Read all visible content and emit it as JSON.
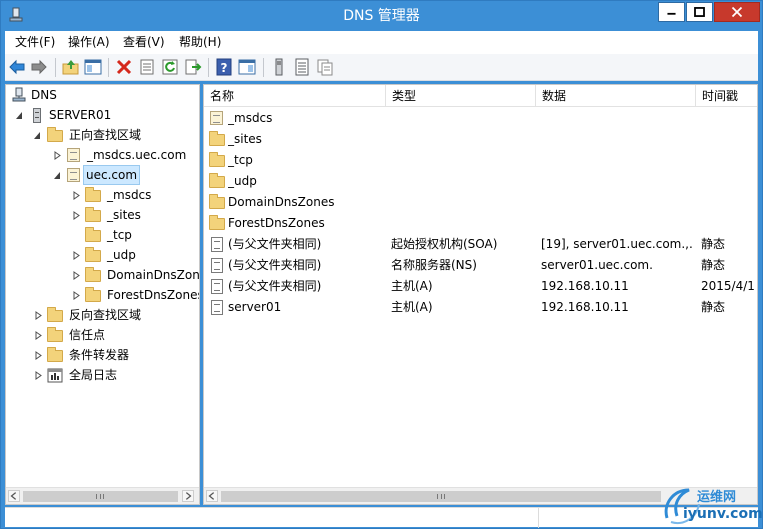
{
  "window": {
    "title": "DNS 管理器",
    "accent": "#3c8fd6",
    "close_color": "#c7392c"
  },
  "menu": {
    "items": [
      {
        "label": "文件(F)"
      },
      {
        "label": "操作(A)"
      },
      {
        "label": "查看(V)"
      },
      {
        "label": "帮助(H)"
      }
    ]
  },
  "toolbar": {
    "buttons": [
      "back-arrow-icon",
      "forward-arrow-icon",
      "up-folder-icon",
      "show-hide-console-tree-icon",
      "delete-icon",
      "properties-icon",
      "refresh-icon",
      "export-list-icon",
      "help-icon",
      "show-hide-action-pane-icon",
      "server-icon",
      "zone-list-icon",
      "copy-record-icon"
    ]
  },
  "tree": {
    "items": [
      {
        "label": "DNS",
        "icon": "dns-root-icon"
      },
      {
        "label": "SERVER01",
        "icon": "server-icon",
        "expander": "expanded"
      },
      {
        "label": "正向查找区域",
        "icon": "folder-icon",
        "expander": "expanded"
      },
      {
        "label": "_msdcs.uec.com",
        "icon": "zone-icon",
        "expander": "collapsed"
      },
      {
        "label": "uec.com",
        "icon": "zone-icon",
        "expander": "expanded",
        "selected": true
      },
      {
        "label": "_msdcs",
        "icon": "folder-icon",
        "expander": "collapsed"
      },
      {
        "label": "_sites",
        "icon": "folder-icon",
        "expander": "collapsed"
      },
      {
        "label": "_tcp",
        "icon": "folder-icon",
        "expander": "none"
      },
      {
        "label": "_udp",
        "icon": "folder-icon",
        "expander": "collapsed"
      },
      {
        "label": "DomainDnsZones",
        "icon": "folder-icon",
        "expander": "collapsed"
      },
      {
        "label": "ForestDnsZones",
        "icon": "folder-icon",
        "expander": "collapsed"
      },
      {
        "label": "反向查找区域",
        "icon": "folder-icon",
        "expander": "collapsed"
      },
      {
        "label": "信任点",
        "icon": "folder-icon",
        "expander": "collapsed"
      },
      {
        "label": "条件转发器",
        "icon": "folder-icon",
        "expander": "collapsed"
      },
      {
        "label": "全局日志",
        "icon": "event-log-icon",
        "expander": "collapsed"
      }
    ]
  },
  "list": {
    "columns": [
      "名称",
      "类型",
      "数据",
      "时间戳"
    ],
    "rows": [
      {
        "icon": "zone-icon",
        "name": "_msdcs",
        "type": "",
        "data": "",
        "timestamp": ""
      },
      {
        "icon": "folder-icon",
        "name": "_sites",
        "type": "",
        "data": "",
        "timestamp": ""
      },
      {
        "icon": "folder-icon",
        "name": "_tcp",
        "type": "",
        "data": "",
        "timestamp": ""
      },
      {
        "icon": "folder-icon",
        "name": "_udp",
        "type": "",
        "data": "",
        "timestamp": ""
      },
      {
        "icon": "folder-icon",
        "name": "DomainDnsZones",
        "type": "",
        "data": "",
        "timestamp": ""
      },
      {
        "icon": "folder-icon",
        "name": "ForestDnsZones",
        "type": "",
        "data": "",
        "timestamp": ""
      },
      {
        "icon": "record-icon",
        "name": "(与父文件夹相同)",
        "type": "起始授权机构(SOA)",
        "data": "[19], server01.uec.com.,...",
        "timestamp": "静态"
      },
      {
        "icon": "record-icon",
        "name": "(与父文件夹相同)",
        "type": "名称服务器(NS)",
        "data": "server01.uec.com.",
        "timestamp": "静态"
      },
      {
        "icon": "record-icon",
        "name": "(与父文件夹相同)",
        "type": "主机(A)",
        "data": "192.168.10.11",
        "timestamp": "2015/4/1"
      },
      {
        "icon": "record-icon",
        "name": "server01",
        "type": "主机(A)",
        "data": "192.168.10.11",
        "timestamp": "静态"
      }
    ]
  },
  "watermark": {
    "line1": "运维网",
    "line2": "iyunv.com"
  }
}
